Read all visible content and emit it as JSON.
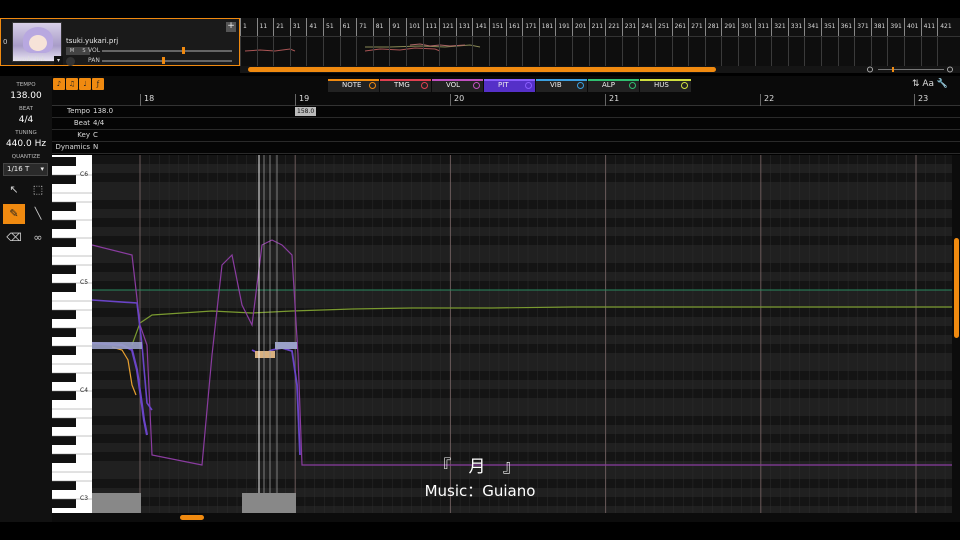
{
  "track": {
    "number": "0",
    "singer_name": "Yuzuki Yuk",
    "project_file": "tsuki.yukari.prj",
    "mute_label": "M",
    "solo_label": "S",
    "vol_label": "VOL",
    "pan_label": "PAN",
    "add_label": "+"
  },
  "timeline": {
    "measures": [
      "1",
      "11",
      "21",
      "31",
      "41",
      "51",
      "61",
      "71",
      "81",
      "91",
      "101",
      "111",
      "121",
      "131",
      "141",
      "151",
      "161",
      "171",
      "181",
      "191",
      "201",
      "211",
      "221",
      "231",
      "241",
      "251",
      "261",
      "271",
      "281",
      "291",
      "301",
      "311",
      "321",
      "331",
      "341",
      "351",
      "361",
      "371",
      "381",
      "391",
      "401",
      "411",
      "421"
    ]
  },
  "param_tabs": [
    {
      "label": "NOTE",
      "color": "#f08a10"
    },
    {
      "label": "TMG",
      "color": "#e04050"
    },
    {
      "label": "VOL",
      "color": "#c050c0"
    },
    {
      "label": "PIT",
      "color": "#8a5cff"
    },
    {
      "label": "VIB",
      "color": "#3ca0e0"
    },
    {
      "label": "ALP",
      "color": "#30c070"
    },
    {
      "label": "HUS",
      "color": "#d0e040"
    }
  ],
  "left_panel": {
    "tempo_label": "TEMPO",
    "tempo_value": "138.00",
    "beat_label": "BEAT",
    "beat_value": "4/4",
    "tuning_label": "TUNING",
    "tuning_value": "440.0 Hz",
    "quantize_label": "QUANTIZE",
    "quantize_value": "1/16 T"
  },
  "ruler": {
    "bars": [
      "18",
      "19",
      "20",
      "21",
      "22",
      "23"
    ],
    "playhead_tempo": "158.0"
  },
  "info_rows": {
    "tempo_label": "Tempo",
    "tempo_value": "138.0",
    "beat_label": "Beat",
    "beat_value": "4/4",
    "key_label": "Key",
    "key_value": "C",
    "dynamics_label": "Dynamics",
    "dynamics_value": "N"
  },
  "octaves": [
    "C6",
    "C5",
    "C4",
    "C3"
  ],
  "right_icons": "⇅ Aa 🔧",
  "subtitle": {
    "title": "『 月 』",
    "credit": "Music：Guiano"
  }
}
